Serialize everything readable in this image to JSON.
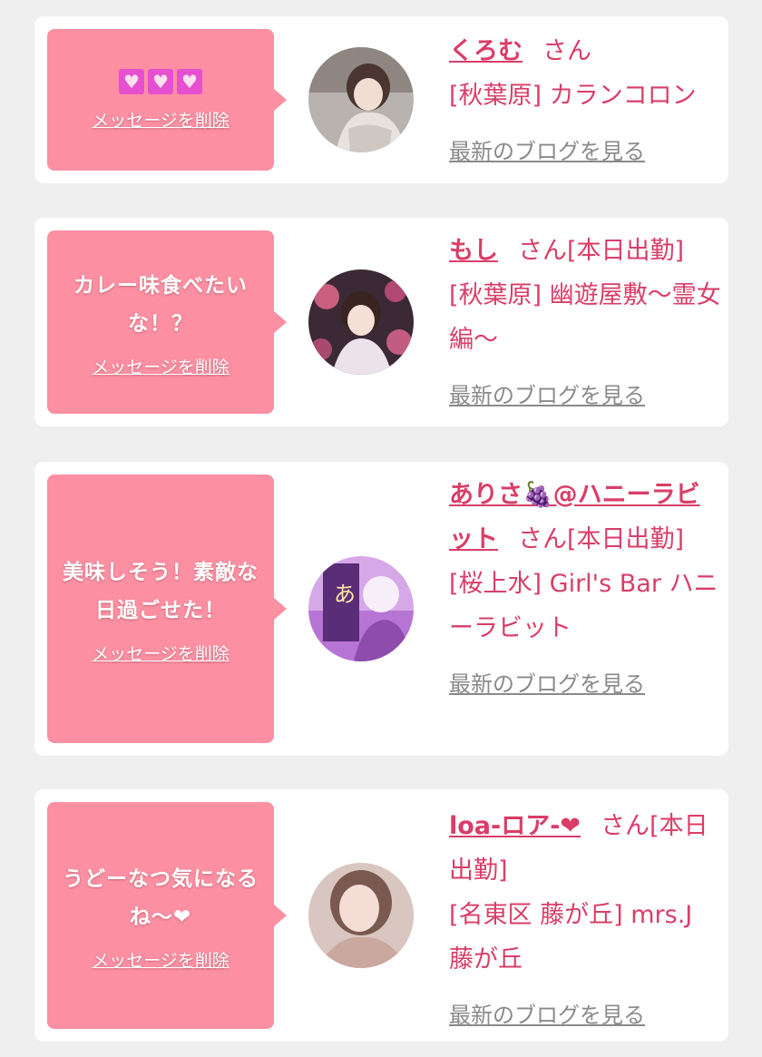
{
  "delete_label": "メッセージを削除",
  "blog_label": "最新のブログを見る",
  "cards": [
    {
      "message": "💗💗💗",
      "message_icons": [
        "heart-icon",
        "heart-icon",
        "heart-icon"
      ],
      "name": "くろむ",
      "honorific": "さん",
      "shop": "[秋葉原] カランコロン"
    },
    {
      "message": "カレー味食べたいな！？",
      "name": "もし",
      "honorific": "さん[本日出勤]",
      "shop": "[秋葉原] 幽遊屋敷〜霊女編〜"
    },
    {
      "message": "美味しそう！素敵な日過ごせた！",
      "name": "ありさ🍇@ハニーラビット",
      "honorific": "さん[本日出勤]",
      "shop": "[桜上水] Girl's Bar ハニーラビット"
    },
    {
      "message": "うどーなつ気になるね〜❤",
      "name": "loa-ロア-❤",
      "honorific": "さん[本日出勤]",
      "shop": "[名東区 藤が丘] mrs.J 藤が丘"
    }
  ],
  "colors": {
    "page_bg": "#efefef",
    "bubble": "#fd8fa2",
    "name_text": "#d93e68",
    "link_gray": "#8a8a8a",
    "heart_box": "#e64fd0"
  }
}
